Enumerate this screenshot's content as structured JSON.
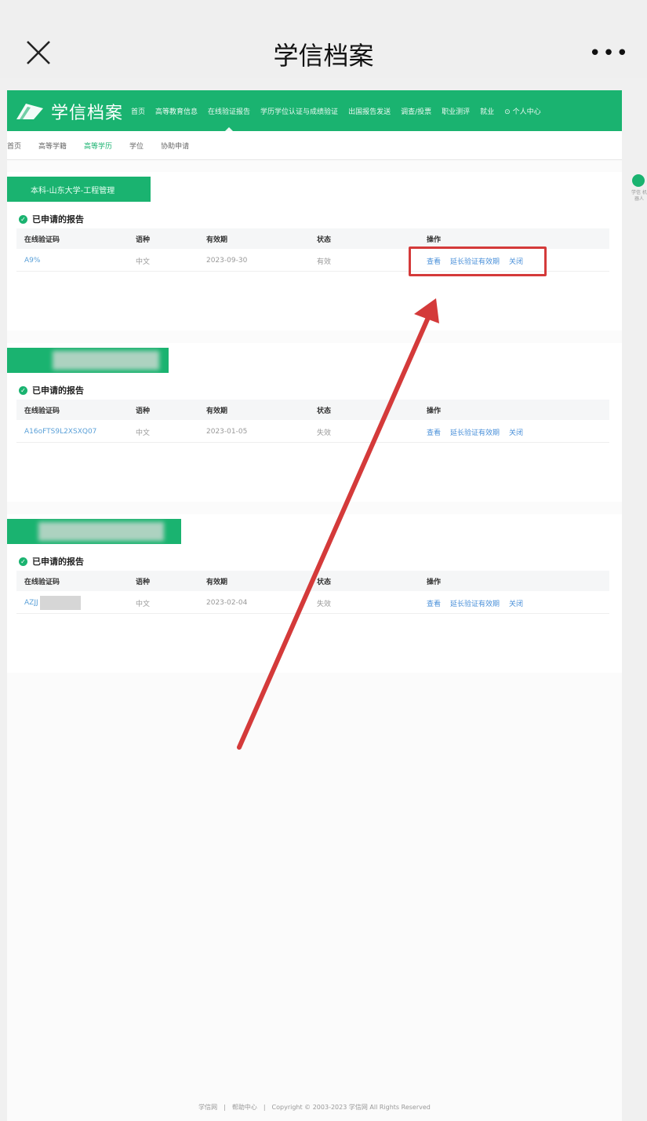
{
  "header": {
    "title": "学信档案"
  },
  "nav": {
    "brand": "学信档案",
    "items": [
      "首页",
      "高等教育信息",
      "在线验证报告",
      "学历学位认证与成绩验证",
      "出国报告发送",
      "调查/投票",
      "职业测评",
      "就业",
      "个人中心"
    ],
    "active_index": 2,
    "accent": "#1ab370"
  },
  "subnav": {
    "items": [
      "首页",
      "高等学籍",
      "高等学历",
      "学位",
      "协助申请"
    ],
    "active_index": 2
  },
  "table_headers": {
    "code": "在线验证码",
    "language": "语种",
    "expiry": "有效期",
    "status": "状态",
    "actions": "操作"
  },
  "section_title": "已申请的报告",
  "cards": [
    {
      "tag": "本科-山东大学-工程管理",
      "row": {
        "code": "A9%",
        "language": "中文",
        "expiry": "2023-09-30",
        "status": "有效"
      },
      "actions": [
        "查看",
        "延长验证有效期",
        "关闭"
      ]
    },
    {
      "tag": "",
      "row": {
        "code": "A16oFTS9L2XSXQ07",
        "language": "中文",
        "expiry": "2023-01-05",
        "status": "失效"
      },
      "actions": [
        "查看",
        "延长验证有效期",
        "关闭"
      ]
    },
    {
      "tag": "",
      "row": {
        "code": "AZJJ",
        "language": "中文",
        "expiry": "2023-02-04",
        "status": "失效"
      },
      "actions": [
        "查看",
        "延长验证有效期",
        "关闭"
      ]
    }
  ],
  "side_widget": {
    "label": "学信 机器人"
  },
  "footer": {
    "link1": "学信网",
    "link2": "帮助中心",
    "copyright": "Copyright © 2003-2023 学信网 All Rights Reserved"
  },
  "colors": {
    "annotation_red": "#d43a3a",
    "link_blue": "#4a90d9"
  }
}
